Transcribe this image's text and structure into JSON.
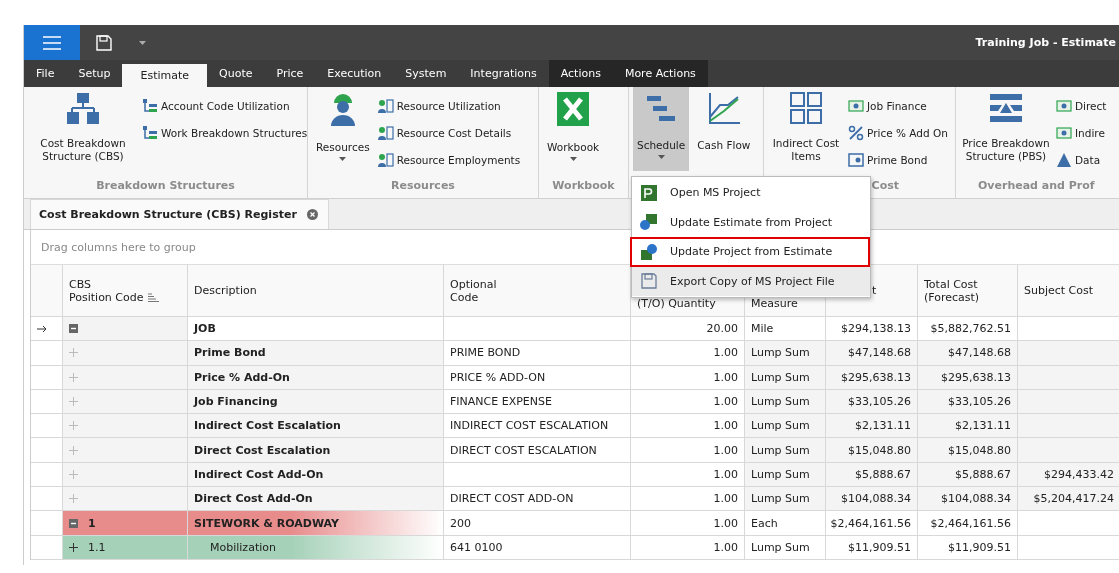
{
  "window": {
    "title": "Training Job - Estimate"
  },
  "tabs": [
    {
      "label": "File",
      "selected": false,
      "kind": "normal"
    },
    {
      "label": "Setup",
      "selected": false,
      "kind": "normal"
    },
    {
      "label": "Estimate",
      "selected": true,
      "kind": "normal"
    },
    {
      "label": "Quote",
      "selected": false,
      "kind": "normal"
    },
    {
      "label": "Price",
      "selected": false,
      "kind": "normal"
    },
    {
      "label": "Execution",
      "selected": false,
      "kind": "normal"
    },
    {
      "label": "System",
      "selected": false,
      "kind": "normal"
    },
    {
      "label": "Integrations",
      "selected": false,
      "kind": "normal"
    },
    {
      "label": "Actions",
      "selected": false,
      "kind": "contextual"
    },
    {
      "label": "More Actions",
      "selected": false,
      "kind": "contextual"
    }
  ],
  "ribbon": [
    {
      "label": "Breakdown Structures",
      "large": [
        {
          "label": "Cost Breakdown Structure (CBS)",
          "dropdown": false,
          "pressed": false
        }
      ],
      "small": [
        {
          "label": "Account Code Utilization"
        },
        {
          "label": "Work Breakdown Structures"
        }
      ]
    },
    {
      "label": "Resources",
      "large": [
        {
          "label": "Resources",
          "dropdown": true,
          "pressed": false
        }
      ],
      "small": [
        {
          "label": "Resource Utilization"
        },
        {
          "label": "Resource Cost Details"
        },
        {
          "label": "Resource Employments"
        }
      ]
    },
    {
      "label": "Workbook",
      "large": [
        {
          "label": "Workbook",
          "dropdown": true,
          "pressed": false
        }
      ]
    },
    {
      "large": [
        {
          "label": "Schedule",
          "dropdown": true,
          "pressed": true
        },
        {
          "label": "Cash Flow",
          "dropdown": false,
          "pressed": false
        }
      ]
    },
    {
      "label": "Cost",
      "large": [
        {
          "label": "Indirect Cost Items",
          "dropdown": false,
          "pressed": false
        }
      ],
      "small": [
        {
          "label": "Job Finance"
        },
        {
          "label": "Price % Add On"
        },
        {
          "label": "Prime Bond"
        }
      ]
    },
    {
      "label": "Overhead and Prof",
      "large": [
        {
          "label": "Price Breakdown Structure (PBS)",
          "dropdown": false,
          "pressed": false
        }
      ],
      "small": [
        {
          "label": "Direct"
        },
        {
          "label": "Indire"
        },
        {
          "label": "Data"
        }
      ]
    }
  ],
  "document_tab": {
    "title": "Cost Breakdown Structure (CBS) Register"
  },
  "group_panel": {
    "placeholder": "Drag columns here to group"
  },
  "table": {
    "columns": [
      "CBS\nPosition Code",
      "Description",
      "Optional\nCode",
      "(T/O) Quantity",
      "Measure",
      "t",
      "Total Cost\n(Forecast)",
      "Subject Cost"
    ],
    "rows": [
      {
        "kind": "job",
        "current": true,
        "expanded": true,
        "code": "",
        "description": "JOB",
        "optional_code": "",
        "quantity": "20.00",
        "measure": "Mile",
        "column_6": "$294,138.13",
        "total_cost": "$5,882,762.51",
        "subject_cost": ""
      },
      {
        "kind": "addon",
        "current": false,
        "expanded": false,
        "code": "",
        "description": "Prime Bond",
        "optional_code": "PRIME BOND",
        "quantity": "1.00",
        "measure": "Lump Sum",
        "column_6": "$47,148.68",
        "total_cost": "$47,148.68",
        "subject_cost": ""
      },
      {
        "kind": "addon",
        "current": false,
        "expanded": false,
        "code": "",
        "description": "Price % Add-On",
        "optional_code": "PRICE % ADD-ON",
        "quantity": "1.00",
        "measure": "Lump Sum",
        "column_6": "$295,638.13",
        "total_cost": "$295,638.13",
        "subject_cost": ""
      },
      {
        "kind": "addon",
        "current": false,
        "expanded": false,
        "code": "",
        "description": "Job Financing",
        "optional_code": "FINANCE EXPENSE",
        "quantity": "1.00",
        "measure": "Lump Sum",
        "column_6": "$33,105.26",
        "total_cost": "$33,105.26",
        "subject_cost": ""
      },
      {
        "kind": "addon",
        "current": false,
        "expanded": false,
        "code": "",
        "description": "Indirect Cost Escalation",
        "optional_code": "INDIRECT COST ESCALATION",
        "quantity": "1.00",
        "measure": "Lump Sum",
        "column_6": "$2,131.11",
        "total_cost": "$2,131.11",
        "subject_cost": ""
      },
      {
        "kind": "addon",
        "current": false,
        "expanded": false,
        "code": "",
        "description": "Direct Cost Escalation",
        "optional_code": "DIRECT COST ESCALATION",
        "quantity": "1.00",
        "measure": "Lump Sum",
        "column_6": "$15,048.80",
        "total_cost": "$15,048.80",
        "subject_cost": ""
      },
      {
        "kind": "addon",
        "current": false,
        "expanded": false,
        "code": "",
        "description": "Indirect Cost Add-On",
        "optional_code": "",
        "quantity": "1.00",
        "measure": "Lump Sum",
        "column_6": "$5,888.67",
        "total_cost": "$5,888.67",
        "subject_cost": "$294,433.42"
      },
      {
        "kind": "addon",
        "current": false,
        "expanded": false,
        "code": "",
        "description": "Direct Cost Add-On",
        "optional_code": "DIRECT COST ADD-ON",
        "quantity": "1.00",
        "measure": "Lump Sum",
        "column_6": "$104,088.34",
        "total_cost": "$104,088.34",
        "subject_cost": "$5,204,417.24"
      },
      {
        "kind": "section",
        "current": false,
        "expanded": true,
        "code": "1",
        "description": "SITEWORK & ROADWAY",
        "optional_code": "200",
        "quantity": "1.00",
        "measure": "Each",
        "column_6": "$2,464,161.56",
        "total_cost": "$2,464,161.56",
        "subject_cost": ""
      },
      {
        "kind": "item",
        "current": false,
        "expanded": false,
        "code": "1.1",
        "description": "Mobilization",
        "optional_code": "641 0100",
        "quantity": "1.00",
        "measure": "Lump Sum",
        "column_6": "$11,909.51",
        "total_cost": "$11,909.51",
        "subject_cost": ""
      }
    ]
  },
  "schedule_menu": {
    "items": [
      {
        "label": "Open MS Project",
        "highlighted": false,
        "hovered": false
      },
      {
        "label": "Update Estimate from Project",
        "highlighted": false,
        "hovered": false
      },
      {
        "label": "Update Project from Estimate",
        "highlighted": true,
        "hovered": false
      },
      {
        "label": "Export Copy of MS Project File",
        "highlighted": false,
        "hovered": true
      }
    ]
  }
}
